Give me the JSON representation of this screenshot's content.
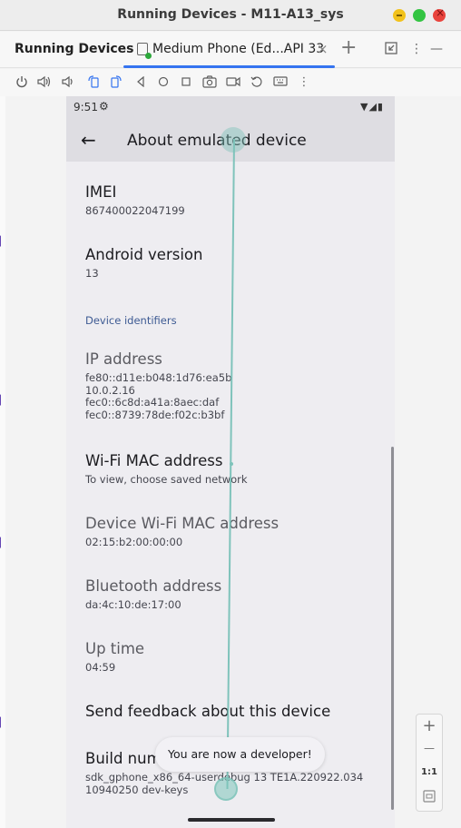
{
  "window": {
    "title": "Running Devices - M11-A13_sys"
  },
  "tabbar": {
    "heading": "Running Devices",
    "tab_label": "Medium Phone (Ed...API 33",
    "tab_close": "×",
    "new_tab": "+",
    "more": "⋮",
    "minimize": "—"
  },
  "toolbar": {
    "icons": [
      "power-icon",
      "volume-up-icon",
      "volume-down-icon",
      "rotate-left-icon",
      "rotate-right-icon",
      "back-icon",
      "home-icon",
      "overview-icon",
      "camera-icon",
      "screen-record-icon",
      "reset-icon",
      "keyboard-icon",
      "more-icon"
    ]
  },
  "device": {
    "status": {
      "time": "9:51"
    },
    "appbar": {
      "title": "About emulated device"
    },
    "prefs": {
      "imei": {
        "title": "IMEI",
        "summary": "867400022047199"
      },
      "android_version": {
        "title": "Android version",
        "summary": "13"
      },
      "section_header": "Device identifiers",
      "ip": {
        "title": "IP address",
        "lines": [
          "fe80::d11e:b048:1d76:ea5b",
          "10.0.2.16",
          "fec0::6c8d:a41a:8aec:daf",
          "fec0::8739:78de:f02c:b3bf"
        ]
      },
      "wifi_mac": {
        "title": "Wi-Fi MAC address",
        "summary": "To view, choose saved network"
      },
      "device_wifi_mac": {
        "title": "Device Wi-Fi MAC address",
        "summary": "02:15:b2:00:00:00"
      },
      "bluetooth": {
        "title": "Bluetooth address",
        "summary": "da:4c:10:de:17:00"
      },
      "uptime": {
        "title": "Up time",
        "summary": "04:59"
      },
      "feedback": {
        "title": "Send feedback about this device"
      },
      "build": {
        "title": "Build num",
        "lines": [
          "sdk_gphone_x86_64-userdebug 13 TE1A.220922.034",
          "10940250 dev-keys"
        ]
      }
    },
    "toast": "You are now a developer!"
  },
  "zoom": {
    "zoom_in": "+",
    "zoom_out": "—",
    "actual": "1:1"
  },
  "colors": {
    "accent": "#3574f0",
    "section_header": "#3d5a93",
    "touch": "#7fc3bb"
  }
}
